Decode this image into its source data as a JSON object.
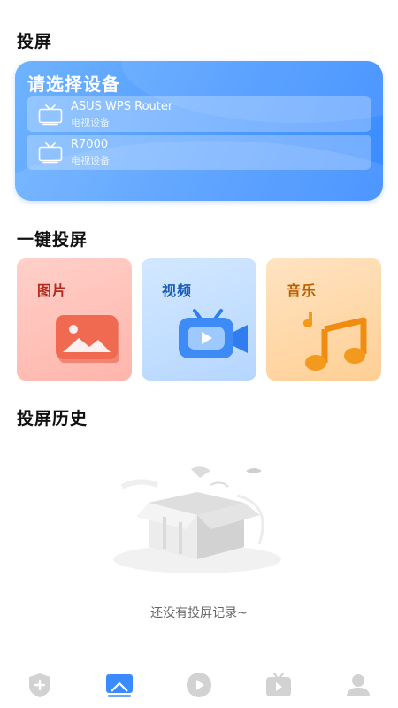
{
  "screen": {
    "cast_section_title": "投屏",
    "quick_cast_title": "一键投屏",
    "history_title": "投屏历史",
    "history_empty_text": "还没有投屏记录~"
  },
  "device_card": {
    "title": "请选择设备",
    "devices": [
      {
        "name": "ASUS WPS Router",
        "type": "电视设备"
      },
      {
        "name": "R7000",
        "type": "电视设备"
      }
    ]
  },
  "quick_cast": {
    "photo_label": "图片",
    "video_label": "视频",
    "music_label": "音乐"
  },
  "bottom_nav": {
    "items": [
      {
        "icon": "shield-plus-icon",
        "active": false
      },
      {
        "icon": "cast-screen-icon",
        "active": true
      },
      {
        "icon": "play-circle-icon",
        "active": false
      },
      {
        "icon": "tv-play-icon",
        "active": false
      },
      {
        "icon": "user-icon",
        "active": false
      }
    ],
    "active_color": "#3a8bff",
    "inactive_color": "#cfcfcf"
  },
  "colors": {
    "accent": "#4f9bff",
    "photo_tile": "#ffb5ab",
    "video_tile": "#b6d6ff",
    "music_tile": "#ffcf94"
  }
}
